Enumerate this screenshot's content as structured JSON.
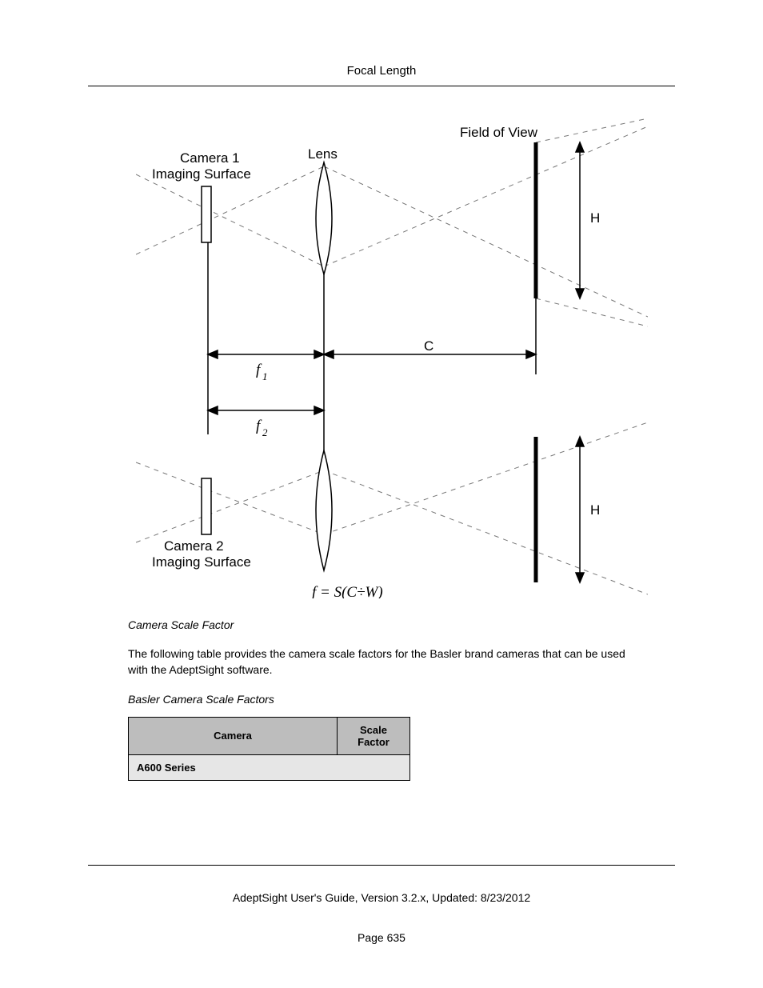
{
  "header": {
    "title": "Focal Length"
  },
  "figure": {
    "labels": {
      "field_of_view": "Field of View",
      "camera1_a": "Camera 1",
      "camera1_b": "Imaging Surface",
      "camera2_a": "Camera 2",
      "camera2_b": "Imaging Surface",
      "lens": "Lens",
      "H1": "H",
      "H2": "H",
      "C": "C",
      "f1": "f",
      "f1_sub": "1",
      "f2": "f",
      "f2_sub": "2",
      "formula": "f = S(C÷W)"
    }
  },
  "captions": {
    "figure_caption": "Camera Scale Factor",
    "table_caption": "Basler Camera Scale Factors"
  },
  "paragraph": "The following table provides the camera scale factors for the Basler brand cameras that can be used with the AdeptSight software.",
  "table": {
    "headers": {
      "camera": "Camera",
      "scale_factor": "Scale Factor"
    },
    "rows": [
      {
        "series": "A600 Series"
      }
    ]
  },
  "footer": {
    "guide": "AdeptSight User's Guide,  Version 3.2.x, Updated: 8/23/2012",
    "page": "Page 635"
  }
}
